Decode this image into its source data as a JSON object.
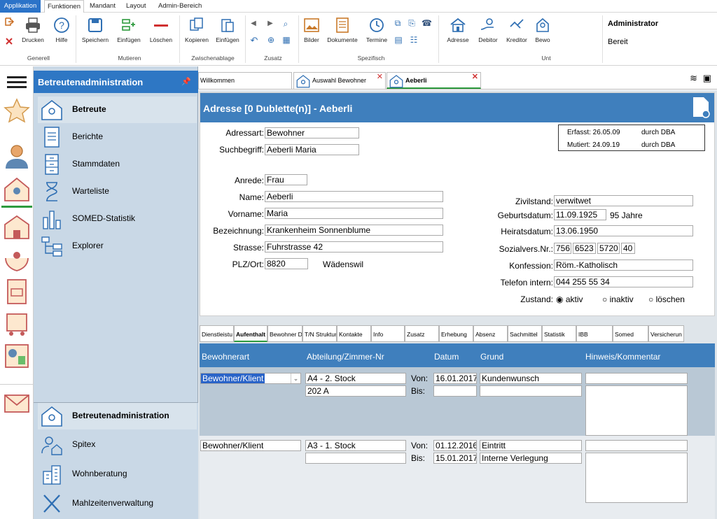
{
  "menu": {
    "items": [
      "Applikation",
      "Funktionen",
      "Mandant",
      "Layout",
      "Admin-Bereich"
    ]
  },
  "ribbon": {
    "buttons": {
      "drucken": "Drucken",
      "hilfe": "Hilfe",
      "speichern": "Speichern",
      "einfuegen": "Einfügen",
      "loeschen": "Löschen",
      "kopieren": "Kopieren",
      "einfuegen2": "Einfügen",
      "bilder": "Bilder",
      "dokumente": "Dokumente",
      "termine": "Termine",
      "adresse": "Adresse",
      "debitor": "Debitor",
      "kreditor": "Kreditor",
      "bewo": "Bewo"
    },
    "groups": {
      "generell": "Generell",
      "mutieren": "Mutieren",
      "zwischenablage": "Zwischenablage",
      "zusatz": "Zusatz",
      "spezifisch": "Spezifisch",
      "unt": "Unt"
    },
    "user": "Administrator",
    "status": "Bereit"
  },
  "nav": {
    "title": "Betreutenadministration",
    "items": [
      "Betreute",
      "Berichte",
      "Stammdaten",
      "Warteliste",
      "SOMED-Statistik",
      "Explorer"
    ],
    "bottom": [
      "Betreutenadministration",
      "Spitex",
      "Wohnberatung",
      "Mahlzeitenverwaltung"
    ]
  },
  "tabs": [
    "Willkommen",
    "Auswahl Bewohner",
    "Aeberli"
  ],
  "form": {
    "title": "Adresse [0 Dublette(n)] - Aeberli",
    "labels": {
      "adressart": "Adressart:",
      "suchbegriff": "Suchbegriff:",
      "anrede": "Anrede:",
      "name": "Name:",
      "vorname": "Vorname:",
      "bezeichnung": "Bezeichnung:",
      "strasse": "Strasse:",
      "plzort": "PLZ/Ort:",
      "zivilstand": "Zivilstand:",
      "geburtsdatum": "Geburtsdatum:",
      "heiratsdatum": "Heiratsdatum:",
      "sozialvers": "Sozialvers.Nr.:",
      "konfession": "Konfession:",
      "telefon": "Telefon intern:",
      "zustand": "Zustand:"
    },
    "values": {
      "adressart": "Bewohner",
      "suchbegriff": "Aeberli Maria",
      "anrede": "Frau",
      "name": "Aeberli",
      "vorname": "Maria",
      "bezeichnung": "Krankenheim Sonnenblume",
      "strasse": "Fuhrstrasse 42",
      "plz": "8820",
      "ort": "Wädenswil",
      "zivilstand": "verwitwet",
      "geburtsdatum": "11.09.1925",
      "alter": "95 Jahre",
      "heiratsdatum": "13.06.1950",
      "sv1": "756",
      "sv2": "6523",
      "sv3": "5720",
      "sv4": "40",
      "konfession": "Röm.-Katholisch",
      "telefon": "044 255 55 34"
    },
    "info": {
      "erfasst": "Erfasst: 26.05.09",
      "erfasst_by": "durch DBA",
      "mutiert": "Mutiert: 24.09.19",
      "mutiert_by": "durch DBA"
    },
    "zustand_options": [
      "aktiv",
      "inaktiv",
      "löschen"
    ],
    "zustand_selected": "aktiv"
  },
  "subtabs": [
    "Dienstleistu",
    "Aufenthalt",
    "Bewohner D",
    "T/N Struktur",
    "Kontakte",
    "Info",
    "Zusatz",
    "Erhebung",
    "Absenz",
    "Sachmittel",
    "Statistik",
    "IBB",
    "Somed",
    "Versicherun"
  ],
  "grid": {
    "headers": [
      "Bewohnerart",
      "Abteilung/Zimmer-Nr",
      "Datum",
      "Grund",
      "Hinweis/Kommentar"
    ],
    "von": "Von:",
    "bis": "Bis:",
    "rows": [
      {
        "art": "Bewohner/Klient",
        "abteilung": "A4 - 2. Stock",
        "zimmer": "202 A",
        "von": "16.01.2017",
        "grund_von": "Kundenwunsch",
        "bis": "",
        "grund_bis": ""
      },
      {
        "art": "Bewohner/Klient",
        "abteilung": "A3 - 1. Stock",
        "zimmer": "",
        "von": "01.12.2016",
        "grund_von": "Eintritt",
        "bis": "15.01.2017",
        "grund_bis": "Interne Verlegung"
      }
    ]
  }
}
